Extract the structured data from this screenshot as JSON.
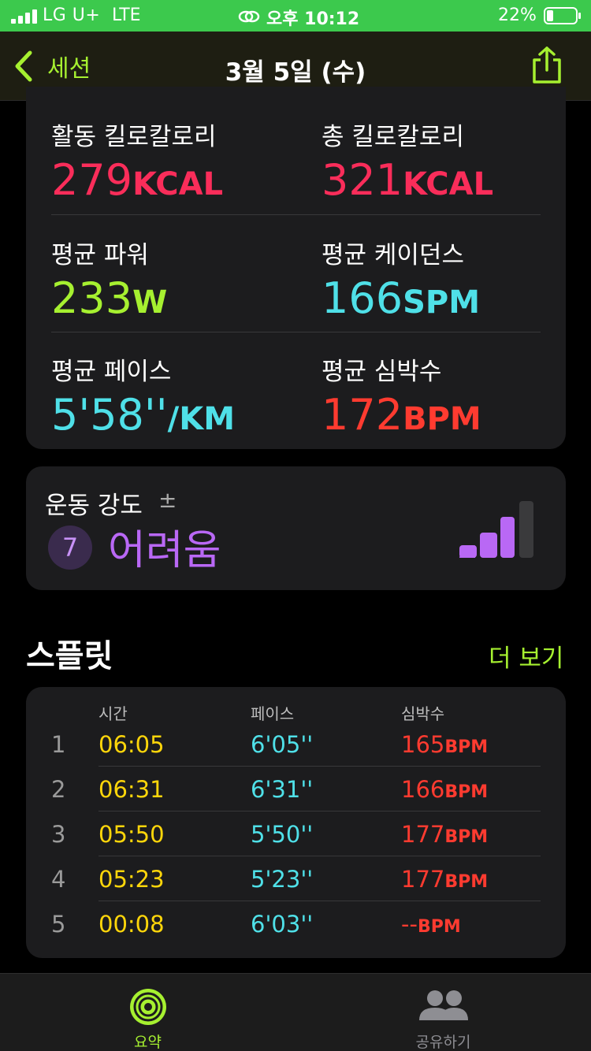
{
  "status_bar": {
    "carrier": "LG U+",
    "network": "LTE",
    "time": "오후 10:12",
    "battery": "22%"
  },
  "nav": {
    "back_label": "세션",
    "title": "3월 5일 (수)"
  },
  "metrics": [
    {
      "label": "활동 킬로칼로리",
      "value": "279",
      "unit": "KCAL",
      "color": "#fa2d5a"
    },
    {
      "label": "총 킬로칼로리",
      "value": "321",
      "unit": "KCAL",
      "color": "#fa2d5a"
    },
    {
      "label": "평균 파워",
      "value": "233",
      "unit": "W",
      "color": "#a6f030"
    },
    {
      "label": "평균 케이던스",
      "value": "166",
      "unit": "SPM",
      "color": "#4fe0e8"
    },
    {
      "label": "평균 페이스",
      "value": "5'58''",
      "unit": "/KM",
      "color": "#4fe0e8"
    },
    {
      "label": "평균 심박수",
      "value": "172",
      "unit": "BPM",
      "color": "#ff3b30"
    }
  ],
  "effort": {
    "label": "운동 강도",
    "adjust_symbol": "±",
    "score": "7",
    "level": "어려움",
    "bars_filled": 3,
    "bars_total": 4
  },
  "splits": {
    "title": "스플릿",
    "more_label": "더 보기",
    "headers": {
      "time": "시간",
      "pace": "페이스",
      "heart_rate": "심박수"
    },
    "unit": "BPM",
    "rows": [
      {
        "num": "1",
        "time": "06:05",
        "pace": "6'05''",
        "hr": "165"
      },
      {
        "num": "2",
        "time": "06:31",
        "pace": "6'31''",
        "hr": "166"
      },
      {
        "num": "3",
        "time": "05:50",
        "pace": "5'50''",
        "hr": "177"
      },
      {
        "num": "4",
        "time": "05:23",
        "pace": "5'23''",
        "hr": "177"
      },
      {
        "num": "5",
        "time": "00:08",
        "pace": "6'03''",
        "hr": "--"
      }
    ]
  },
  "tabs": [
    {
      "label": "요약",
      "icon": "activity-rings-icon",
      "active": true
    },
    {
      "label": "공유하기",
      "icon": "people-icon",
      "active": false
    }
  ],
  "colors": {
    "accent": "#a6f030",
    "status_bar": "#3cc94d",
    "card": "#1c1c1e"
  }
}
